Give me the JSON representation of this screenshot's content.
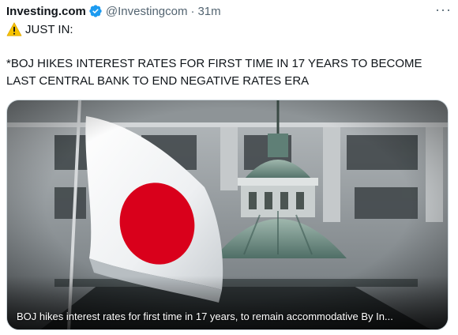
{
  "tweet": {
    "author_name": "Investing.com",
    "author_handle": "@Investingcom",
    "separator": "·",
    "timestamp": "31m",
    "more_label": "···",
    "line1": "JUST IN:",
    "body": "*BOJ HIKES INTEREST RATES FOR FIRST TIME IN 17 YEARS TO BECOME\nLAST CENTRAL BANK TO END NEGATIVE RATES ERA"
  },
  "media": {
    "caption": "BOJ hikes interest rates for first time in 17 years, to remain accommodative By In..."
  },
  "icons": {
    "verified": "verified-badge-icon",
    "warning": "warning-icon",
    "more": "more-icon"
  },
  "colors": {
    "verified_blue": "#1d9bf0",
    "text_secondary": "#536471",
    "flag_red": "#d9001b"
  }
}
